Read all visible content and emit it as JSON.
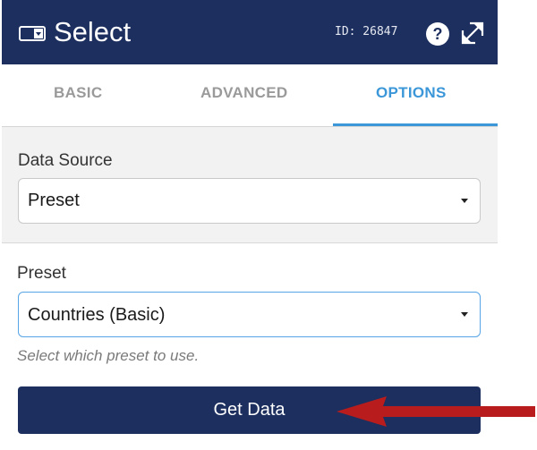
{
  "header": {
    "title": "Select",
    "id_text": "ID: 26847",
    "icons": {
      "widget": "select-widget-icon",
      "help": "help-icon",
      "expand": "expand-icon"
    }
  },
  "tabs": [
    {
      "label": "BASIC",
      "active": false
    },
    {
      "label": "ADVANCED",
      "active": false
    },
    {
      "label": "OPTIONS",
      "active": true
    }
  ],
  "data_source": {
    "label": "Data Source",
    "value": "Preset"
  },
  "preset": {
    "label": "Preset",
    "value": "Countries (Basic)",
    "help": "Select which preset to use."
  },
  "actions": {
    "get_data": "Get Data"
  },
  "colors": {
    "header_bg": "#1c2f5e",
    "tab_active": "#3b97d8",
    "arrow": "#b81c1c"
  }
}
